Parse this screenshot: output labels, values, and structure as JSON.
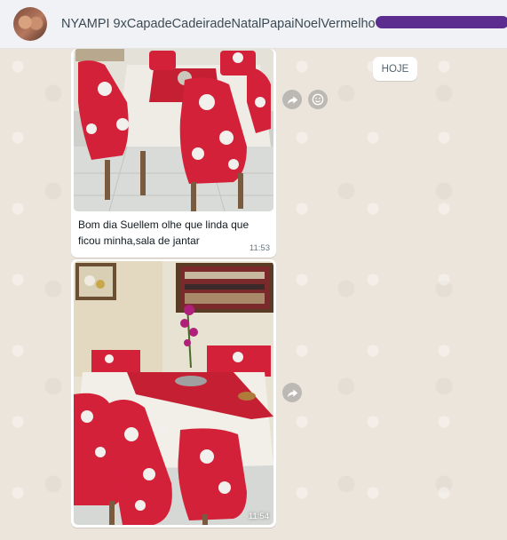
{
  "contact": {
    "name": "NYAMPI 9xCapadeCadeiradeNatalPapaiNoelVermelho"
  },
  "date_chip": "HOJE",
  "messages": [
    {
      "caption": "Bom dia Suellem olhe que linda que ficou minha,sala de jantar",
      "time": "11:53"
    },
    {
      "caption": "",
      "time": "11:54"
    }
  ],
  "icons": {
    "forward": "forward-icon",
    "emoji": "emoji-icon"
  },
  "colors": {
    "header_bg": "#f0f2f5",
    "chat_bg": "#ece5dc",
    "redaction": "#5b2d8e",
    "chair_red": "#d4213a"
  }
}
